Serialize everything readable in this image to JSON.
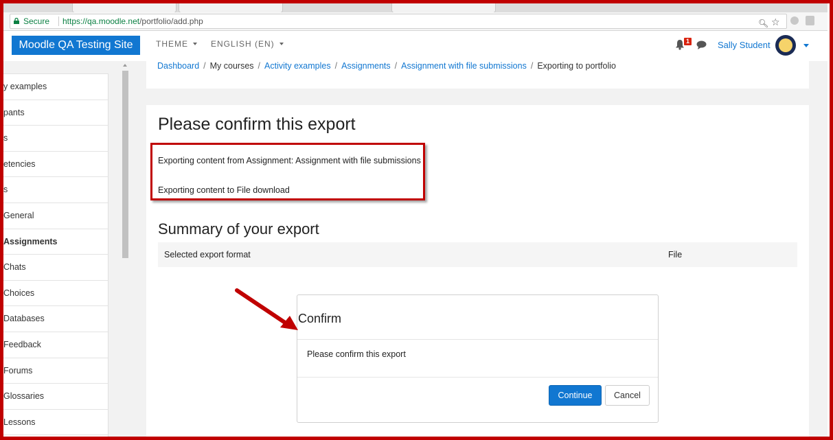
{
  "browser": {
    "secure_label": "Secure",
    "url_host": "https://qa.moodle.net",
    "url_path": "/portfolio/add.php"
  },
  "navbar": {
    "brand": "Moodle QA Testing Site",
    "menus": [
      "THEME",
      "ENGLISH (EN)"
    ],
    "notification_count": "1",
    "user_name": "Sally Student"
  },
  "breadcrumb": [
    {
      "label": "Dashboard",
      "link": true
    },
    {
      "label": "My courses",
      "link": false
    },
    {
      "label": "Activity examples",
      "link": true
    },
    {
      "label": "Assignments",
      "link": true
    },
    {
      "label": "Assignment with file submissions",
      "link": true
    },
    {
      "label": "Exporting to portfolio",
      "link": false
    }
  ],
  "sidebar": {
    "items": [
      {
        "label": "y examples",
        "active": false
      },
      {
        "label": "pants",
        "active": false
      },
      {
        "label": "s",
        "active": false
      },
      {
        "label": "etencies",
        "active": false
      },
      {
        "label": "s",
        "active": false
      },
      {
        "label": "General",
        "active": false
      },
      {
        "label": "Assignments",
        "active": true
      },
      {
        "label": "Chats",
        "active": false
      },
      {
        "label": "Choices",
        "active": false
      },
      {
        "label": "Databases",
        "active": false
      },
      {
        "label": "Feedback",
        "active": false
      },
      {
        "label": "Forums",
        "active": false
      },
      {
        "label": "Glossaries",
        "active": false
      },
      {
        "label": "Lessons",
        "active": false
      }
    ]
  },
  "main": {
    "title": "Please confirm this export",
    "info": {
      "from": "Exporting content from Assignment: Assignment with file submissions",
      "to": "Exporting content to File download"
    },
    "summary": {
      "title": "Summary of your export",
      "row_label": "Selected export format",
      "row_value": "File"
    }
  },
  "modal": {
    "title": "Confirm",
    "body": "Please confirm this export",
    "continue_label": "Continue",
    "cancel_label": "Cancel"
  },
  "colors": {
    "brand": "#1177d1",
    "annotation": "#c00000",
    "secure": "#0b8043"
  }
}
